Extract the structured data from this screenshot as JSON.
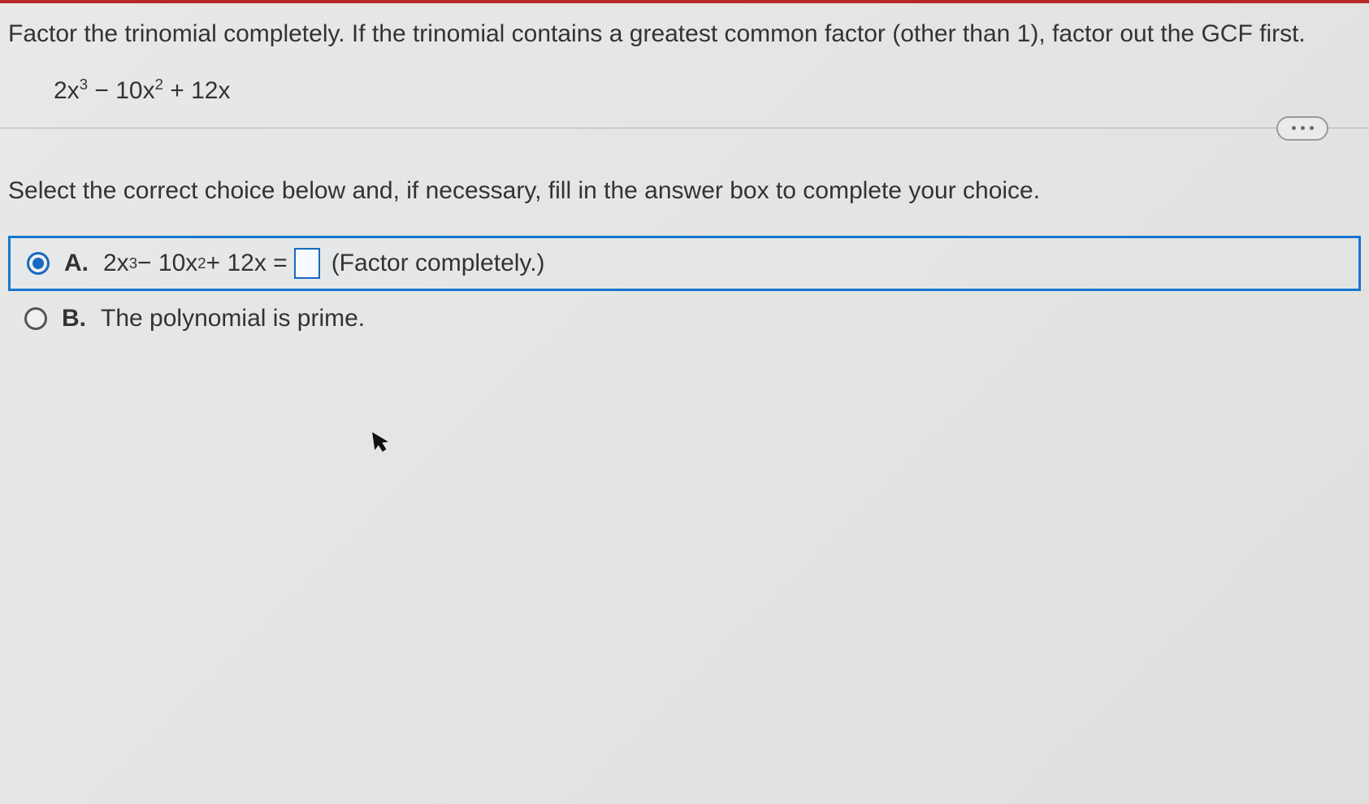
{
  "question": {
    "prompt": "Factor the trinomial completely. If the trinomial contains a greatest common factor (other than 1), factor out the GCF first.",
    "expression": {
      "term1_coef": "2x",
      "term1_exp": "3",
      "term2": " − 10x",
      "term2_exp": "2",
      "term3": " + 12x"
    }
  },
  "instruction": "Select the correct choice below and, if necessary, fill in the answer box to complete your choice.",
  "choices": {
    "A": {
      "label": "A.",
      "expr_prefix_coef": "2x",
      "expr_prefix_exp": "3",
      "expr_mid": " − 10x",
      "expr_mid_exp": "2",
      "expr_tail": " + 12x = ",
      "hint": "(Factor completely.)",
      "selected": true
    },
    "B": {
      "label": "B.",
      "text": "The polynomial is prime.",
      "selected": false
    }
  },
  "icons": {
    "more": "more-options"
  }
}
